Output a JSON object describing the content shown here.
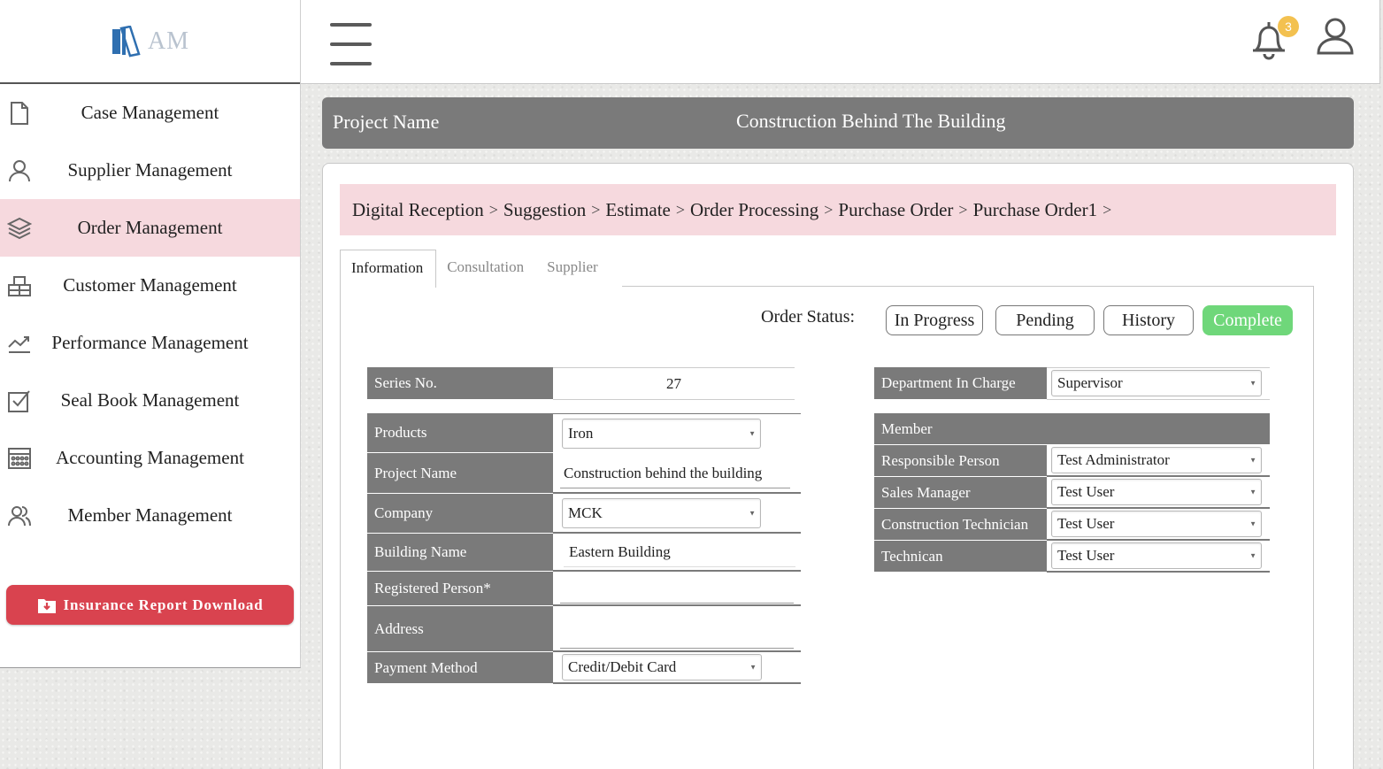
{
  "app": {
    "logo_text": "AM"
  },
  "sidebar": {
    "items": [
      {
        "label": "Case Management",
        "icon": "document-icon"
      },
      {
        "label": "Supplier Management",
        "icon": "user-icon"
      },
      {
        "label": "Order Management",
        "icon": "layers-icon",
        "active": true
      },
      {
        "label": "Customer Management",
        "icon": "boxes-icon"
      },
      {
        "label": "Performance Management",
        "icon": "trend-icon"
      },
      {
        "label": "Seal Book Management",
        "icon": "checkbox-icon"
      },
      {
        "label": "Accounting Management",
        "icon": "calculator-icon"
      },
      {
        "label": "Member Management",
        "icon": "users-icon"
      }
    ],
    "download_label": "Insurance Report Download"
  },
  "header": {
    "notification_count": "3"
  },
  "project": {
    "label": "Project Name",
    "value": "Construction Behind The Building"
  },
  "breadcrumb": [
    "Digital Reception",
    "Suggestion",
    "Estimate",
    "Order Processing",
    "Purchase Order",
    "Purchase Order1"
  ],
  "breadcrumb_sep": ">",
  "tabs": [
    {
      "label": "Information",
      "active": true
    },
    {
      "label": "Consultation"
    },
    {
      "label": "Supplier"
    }
  ],
  "order_status": {
    "label": "Order Status:",
    "options": [
      "In Progress",
      "Pending",
      "History",
      "Complete"
    ],
    "selected": "Complete",
    "selected_color": "#6fd77a"
  },
  "form_left": {
    "series_no": {
      "label": "Series No.",
      "value": "27"
    },
    "products": {
      "label": "Products",
      "value": "Iron"
    },
    "project_name": {
      "label": "Project Name",
      "value": "Construction behind the building"
    },
    "company": {
      "label": "Company",
      "value": "MCK"
    },
    "building_name": {
      "label": "Building Name",
      "value": "Eastern Building"
    },
    "registered_person": {
      "label": "Registered Person*",
      "value": ""
    },
    "address": {
      "label": "Address",
      "value": ""
    },
    "payment_method": {
      "label": "Payment Method",
      "value": "Credit/Debit Card"
    }
  },
  "form_right": {
    "department": {
      "label": "Department In Charge",
      "value": "Supervisor"
    },
    "member_header": "Member",
    "members": [
      {
        "label": "Responsible Person",
        "value": "Test Administrator"
      },
      {
        "label": "Sales Manager",
        "value": "Test User"
      },
      {
        "label": "Construction Technician",
        "value": "Test User"
      },
      {
        "label": "Technican",
        "value": "Test User"
      }
    ]
  },
  "colors": {
    "accent_pink": "#f6d9de",
    "header_gray": "#7a7a7a",
    "danger_red": "#d9434f",
    "badge_yellow": "#f3c150"
  }
}
